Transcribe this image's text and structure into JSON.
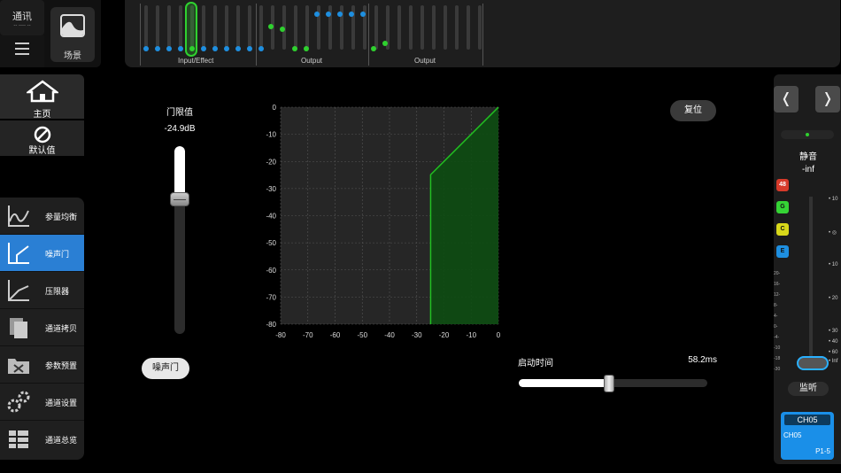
{
  "top_left": {
    "comm_label": "通讯",
    "comm_sub": "-- ---- --",
    "scene_label": "场景"
  },
  "strip": {
    "groups": [
      "Input/Effect",
      "Output",
      "Output"
    ]
  },
  "nav": {
    "home": "主页",
    "defaults": "默认值",
    "items": [
      {
        "label": "参量均衡",
        "icon": "eq-curve-icon",
        "active": false
      },
      {
        "label": "噪声门",
        "icon": "gate-curve-icon",
        "active": true
      },
      {
        "label": "压限器",
        "icon": "compressor-curve-icon",
        "active": false
      },
      {
        "label": "通道拷贝",
        "icon": "copy-icon",
        "active": false
      },
      {
        "label": "参数预置",
        "icon": "preset-folder-icon",
        "active": false
      },
      {
        "label": "通道设置",
        "icon": "gears-icon",
        "active": false
      },
      {
        "label": "通道总览",
        "icon": "overview-list-icon",
        "active": false
      }
    ]
  },
  "gate": {
    "threshold_title": "门限值",
    "threshold_value": "-24.9dB",
    "threshold_db": -24.9,
    "toggle_label": "噪声门",
    "reset_label": "复位",
    "attack_title": "启动时间",
    "attack_value": "58.2ms",
    "attack_fraction": 0.48
  },
  "chart_data": {
    "type": "line",
    "xlabel": "",
    "ylabel": "",
    "xlim": [
      -80,
      0
    ],
    "ylim": [
      -80,
      0
    ],
    "x_ticks": [
      "-80",
      "-70",
      "-60",
      "-50",
      "-40",
      "-30",
      "-20",
      "-10",
      "0"
    ],
    "y_ticks": [
      "0",
      "-10",
      "-20",
      "-30",
      "-40",
      "-50",
      "-60",
      "-70",
      "-80"
    ],
    "series": [
      {
        "x": [
          -24.9,
          -24.9,
          0
        ],
        "y": [
          -80,
          -24.9,
          0
        ]
      }
    ],
    "grid": true,
    "colors": {
      "line": "#21c021",
      "fill": "#0d4d12",
      "bg": "#262626"
    }
  },
  "right": {
    "prev": "❬",
    "next": "❭",
    "mute_label": "静音",
    "level_label": "-inf",
    "tags": [
      "48",
      "G",
      "C",
      "E"
    ],
    "meter_scale": [
      "20-",
      "16-",
      "12-",
      "8-",
      "4-",
      "0-",
      "-4-",
      "-10",
      "-18",
      "-30"
    ],
    "fader_scale": [
      "10",
      "◎",
      "10",
      "20",
      "30",
      "40",
      "60",
      "Inf"
    ],
    "monitor_label": "监听",
    "channel": {
      "header": "CH05",
      "name": "CH05",
      "page": "P1-5"
    }
  }
}
